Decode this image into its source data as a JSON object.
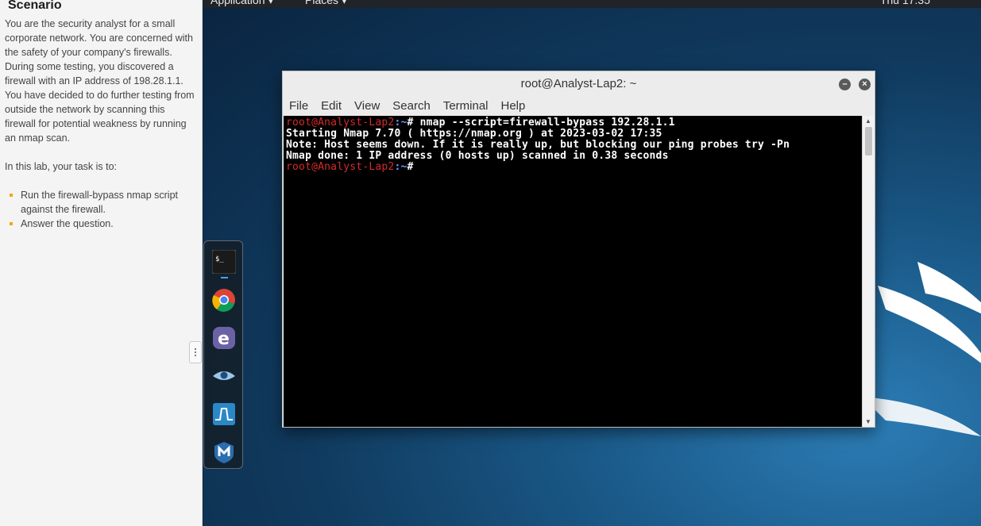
{
  "scenario": {
    "title": "Scenario",
    "paragraph": "You are the security analyst for a small corporate network. You are concerned with the safety of your company's firewalls. During some testing, you discovered a firewall with an IP address of 198.28.1.1. You have decided to do further testing from outside the network by scanning this firewall for potential weakness by running an nmap scan.",
    "task_intro": "In this lab, your task is to:",
    "tasks": [
      "Run the firewall-bypass nmap script against the firewall.",
      "Answer the question."
    ]
  },
  "topbar": {
    "applications": "Application ▾",
    "places": "Places ▾",
    "clock": "Thu 17:35"
  },
  "dock": {
    "items": [
      "terminal-icon",
      "chrome-icon",
      "emacs-icon",
      "eye-icon",
      "wireshark-icon",
      "metasploit-icon"
    ]
  },
  "terminal": {
    "title": "root@Analyst-Lap2: ~",
    "menu": [
      "File",
      "Edit",
      "View",
      "Search",
      "Terminal",
      "Help"
    ],
    "prompt_user": "root@Analyst-Lap2",
    "prompt_path": ":~",
    "prompt_symbol": "# ",
    "command": "nmap --script=firewall-bypass 192.28.1.1",
    "output": [
      "Starting Nmap 7.70 ( https://nmap.org ) at 2023-03-02 17:35",
      "Note: Host seems down. If it is really up, but blocking our ping probes try -Pn",
      "Nmap done: 1 IP address (0 hosts up) scanned in 0.38 seconds"
    ]
  }
}
